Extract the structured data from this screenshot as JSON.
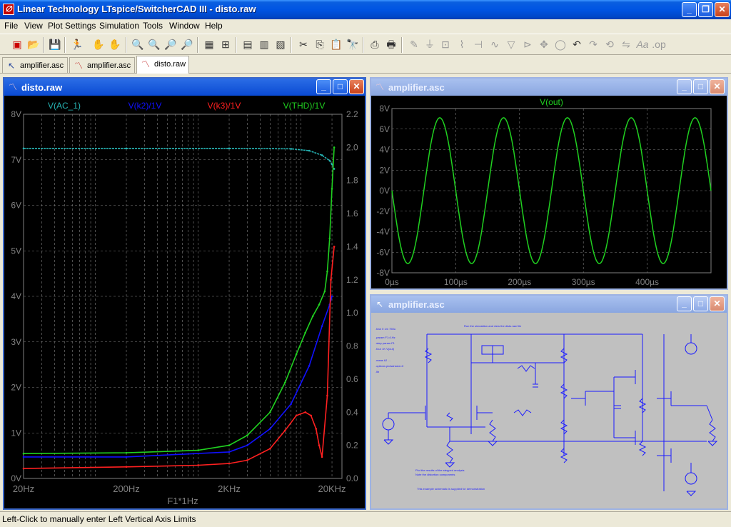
{
  "app": {
    "title": "Linear Technology LTspice/SwitcherCAD III - disto.raw",
    "icon": "ltspice-logo-icon"
  },
  "menu": [
    "File",
    "View",
    "Plot Settings",
    "Simulation",
    "Tools",
    "Window",
    "Help"
  ],
  "tabs": [
    {
      "label": "amplifier.asc",
      "icon": "schematic-icon",
      "active": false
    },
    {
      "label": "amplifier.asc",
      "icon": "waveform-icon",
      "active": false
    },
    {
      "label": "disto.raw",
      "icon": "waveform-icon",
      "active": true
    }
  ],
  "windows": {
    "disto": {
      "title": "disto.raw",
      "traces": [
        {
          "name": "V(AC_1)",
          "color": "#26b3b3"
        },
        {
          "name": "V(k2)/1V",
          "color": "#1010ff"
        },
        {
          "name": "V(k3)/1V",
          "color": "#ff2020"
        },
        {
          "name": "V(THD)/1V",
          "color": "#20d020"
        }
      ],
      "left_ticks": [
        "8V",
        "7V",
        "6V",
        "5V",
        "4V",
        "3V",
        "2V",
        "1V",
        "0V"
      ],
      "right_ticks": [
        "2.2",
        "2.0",
        "1.8",
        "1.6",
        "1.4",
        "1.2",
        "1.0",
        "0.8",
        "0.6",
        "0.4",
        "0.2",
        "0.0"
      ],
      "x_ticks": [
        "20Hz",
        "200Hz",
        "2KHz",
        "20KHz"
      ],
      "x_label": "F1*1Hz"
    },
    "transient": {
      "title": "amplifier.asc",
      "trace": {
        "name": "V(out)",
        "color": "#20d020"
      },
      "y_ticks": [
        "8V",
        "6V",
        "4V",
        "2V",
        "0V",
        "-2V",
        "-4V",
        "-6V",
        "-8V"
      ],
      "x_ticks": [
        "0µs",
        "100µs",
        "200µs",
        "300µs",
        "400µs"
      ]
    },
    "schematic": {
      "title": "amplifier.asc"
    }
  },
  "chart_data": [
    {
      "type": "line",
      "title": "",
      "xlabel": "F1*1Hz",
      "x_scale": "log",
      "xlim_hz": [
        20,
        25000
      ],
      "left_axis": {
        "unit": "V",
        "ylim": [
          0,
          8
        ]
      },
      "right_axis": {
        "ylim": [
          0,
          2.2
        ]
      },
      "grid": true,
      "series": [
        {
          "name": "V(AC_1)",
          "axis": "left",
          "x_hz": [
            20,
            200,
            2000,
            8000,
            12000,
            16000,
            19000,
            20000,
            21000
          ],
          "values": [
            7.25,
            7.25,
            7.25,
            7.24,
            7.2,
            7.1,
            6.98,
            6.9,
            6.8
          ]
        },
        {
          "name": "V(k2)/1V",
          "axis": "right",
          "x_hz": [
            20,
            200,
            2000,
            3000,
            5000,
            8000,
            12000,
            16000,
            19000,
            20000
          ],
          "values": [
            0.13,
            0.13,
            0.16,
            0.2,
            0.3,
            0.45,
            0.68,
            0.92,
            1.05,
            1.1
          ]
        },
        {
          "name": "V(k3)/1V",
          "axis": "right",
          "x_hz": [
            20,
            200,
            1000,
            2000,
            3000,
            5000,
            7000,
            9000,
            11000,
            12500,
            14000,
            15000,
            16000,
            18000,
            19500,
            21000
          ],
          "values": [
            0.06,
            0.07,
            0.08,
            0.09,
            0.11,
            0.18,
            0.29,
            0.38,
            0.4,
            0.38,
            0.3,
            0.2,
            0.13,
            0.5,
            1.2,
            1.4
          ]
        },
        {
          "name": "V(THD)/1V",
          "axis": "right",
          "x_hz": [
            20,
            200,
            1000,
            2000,
            3000,
            5000,
            7000,
            9000,
            11000,
            13000,
            15000,
            17000,
            18000,
            19000,
            20000,
            21000
          ],
          "values": [
            0.15,
            0.155,
            0.17,
            0.2,
            0.26,
            0.4,
            0.58,
            0.75,
            0.88,
            0.98,
            1.05,
            1.13,
            1.25,
            1.45,
            1.75,
            2.0
          ]
        }
      ]
    },
    {
      "type": "line",
      "title": "",
      "xlabel": "",
      "xlim_us": [
        0,
        500
      ],
      "ylim": [
        -8,
        8
      ],
      "grid": true,
      "series": [
        {
          "name": "V(out)",
          "waveform": "sine",
          "amplitude": 7.1,
          "frequency_khz": 10,
          "phase_deg": 180
        }
      ]
    }
  ],
  "status": {
    "text": "Left-Click to manually enter Left Vertical Axis Limits"
  }
}
